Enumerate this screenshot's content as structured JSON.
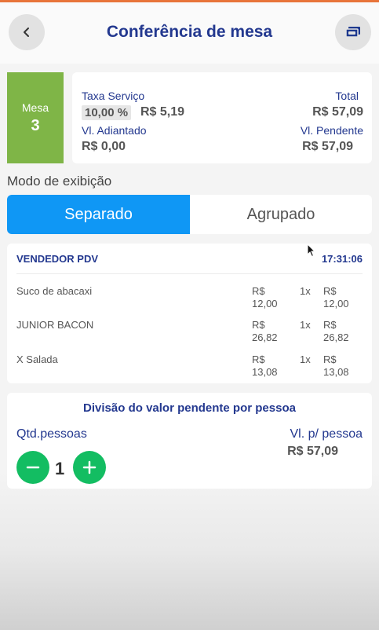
{
  "header": {
    "title": "Conferência de mesa",
    "back_icon": "chevron-left-icon",
    "action_icon": "cash-icon"
  },
  "table": {
    "label": "Mesa",
    "number": "3"
  },
  "summary": {
    "service_fee_label": "Taxa Serviço",
    "service_fee_percent": "10,00 %",
    "service_fee_value": "R$ 5,19",
    "total_label": "Total",
    "total_value": "R$ 57,09",
    "advance_label": "Vl. Adiantado",
    "advance_value": "R$ 0,00",
    "pending_label": "Vl. Pendente",
    "pending_value": "R$ 57,09"
  },
  "display_mode": {
    "label": "Modo de exibição",
    "options": [
      "Separado",
      "Agrupado"
    ],
    "selected": "Separado"
  },
  "orders": {
    "seller": "VENDEDOR PDV",
    "time": "17:31:06",
    "items": [
      {
        "name": "Suco de abacaxi",
        "price_currency": "R$",
        "price": "12,00",
        "qty": "1x",
        "total_currency": "R$",
        "total": "12,00"
      },
      {
        "name": "JUNIOR BACON",
        "price_currency": "R$",
        "price": "26,82",
        "qty": "1x",
        "total_currency": "R$",
        "total": "26,82"
      },
      {
        "name": "X Salada",
        "price_currency": "R$",
        "price": "13,08",
        "qty": "1x",
        "total_currency": "R$",
        "total": "13,08"
      }
    ]
  },
  "split": {
    "title": "Divisão do valor pendente por pessoa",
    "people_label": "Qtd.pessoas",
    "people_count": "1",
    "per_person_label": "Vl. p/ pessoa",
    "per_person_value": "R$ 57,09"
  },
  "colors": {
    "accent_blue": "#0f97f5",
    "title_navy": "#23388f",
    "table_green": "#7fb547",
    "button_green": "#13bd62",
    "top_line_orange": "#e8743a"
  }
}
